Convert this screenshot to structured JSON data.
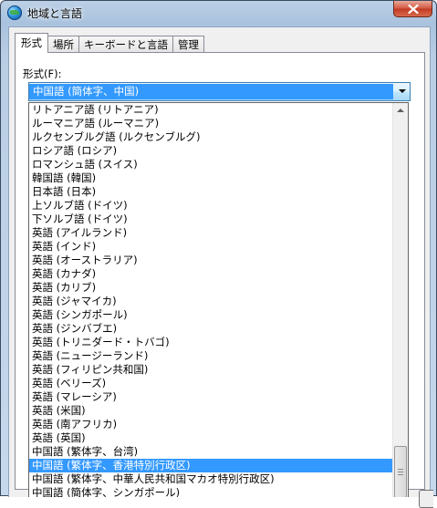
{
  "window": {
    "title": "地域と言語",
    "close_icon": "close-icon"
  },
  "tabs": [
    {
      "label": "形式",
      "active": true
    },
    {
      "label": "場所",
      "active": false
    },
    {
      "label": "キーボードと言語",
      "active": false
    },
    {
      "label": "管理",
      "active": false
    }
  ],
  "format": {
    "label": "形式(F):",
    "selected": "中国語 (簡体字、中国)"
  },
  "dropdown": {
    "items": [
      "リトアニア語 (リトアニア)",
      "ルーマニア語 (ルーマニア)",
      "ルクセンブルグ語 (ルクセンブルグ)",
      "ロシア語 (ロシア)",
      "ロマンシュ語 (スイス)",
      "韓国語 (韓国)",
      "日本語 (日本)",
      "上ソルブ語 (ドイツ)",
      "下ソルブ語 (ドイツ)",
      "英語 (アイルランド)",
      "英語 (インド)",
      "英語 (オーストラリア)",
      "英語 (カナダ)",
      "英語 (カリブ)",
      "英語 (ジャマイカ)",
      "英語 (シンガポール)",
      "英語 (ジンバブエ)",
      "英語 (トリニダード・トバゴ)",
      "英語 (ニュージーランド)",
      "英語 (フィリピン共和国)",
      "英語 (ベリーズ)",
      "英語 (マレーシア)",
      "英語 (米国)",
      "英語 (南アフリカ)",
      "英語 (英国)",
      "中国語 (繁体字、台湾)",
      "中国語 (繁体字、香港特別行政区)",
      "中国語 (繁体字、中華人民共和国マカオ特別行政区)",
      "中国語 (簡体字、シンガポール)"
    ],
    "highlighted": "中国語 (繁体字、香港特別行政区)"
  },
  "colors": {
    "selection": "#3399ff",
    "close_button": "#c23a22"
  }
}
